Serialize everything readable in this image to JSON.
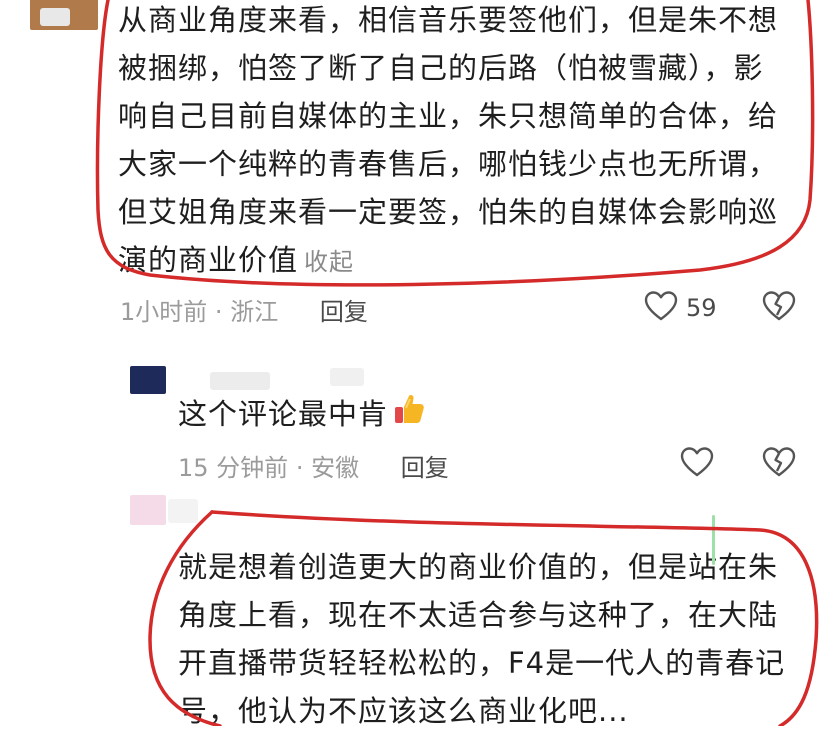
{
  "comments": [
    {
      "lines": [
        "从商业角度来看，相信音乐要签他们，但是朱不想",
        "被捆绑，怕签了断了自己的后路（怕被雪藏），影",
        "响自己目前自媒体的主业，朱只想简单的合体，给",
        "大家一个纯粹的青春售后，哪怕钱少点也无所谓，",
        "但艾姐角度来看一定要签，怕朱的自媒体会影响巡",
        "演的商业价值"
      ],
      "collapse_label": "收起",
      "time": "1小时前",
      "separator": "·",
      "location": "浙江",
      "reply_label": "回复",
      "like_count": "59",
      "avatar_color": "#b07a4a"
    },
    {
      "lines": [
        "这个评论最中肯"
      ],
      "time": "15 分钟前",
      "separator": "·",
      "location": "安徽",
      "reply_label": "回复",
      "avatar_color": "#1e2a5a"
    },
    {
      "lines": [
        "就是想着创造更大的商业价值的，但是站在朱",
        "角度上看，现在不太适合参与这种了，在大陆",
        "开直播带货轻轻松松的，F4是一代人的青春记",
        "号，他认为不应该这么商业化吧..."
      ],
      "avatar_color": "#f5dbe8"
    }
  ],
  "colors": {
    "annotation_red": "#d42a2a",
    "meta_gray": "#9b9b9b"
  }
}
